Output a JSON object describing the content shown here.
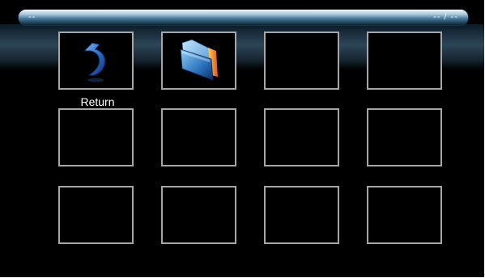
{
  "path_bar": {
    "path_text": "--",
    "page_counter": "-- / --"
  },
  "grid": {
    "items": [
      {
        "label": "Return",
        "icon": "return-arrow-icon",
        "selected": false
      },
      {
        "label": "",
        "icon": "folder-icon",
        "selected": false
      },
      {
        "label": "",
        "icon": "",
        "selected": false
      },
      {
        "label": "",
        "icon": "",
        "selected": false
      },
      {
        "label": "",
        "icon": "",
        "selected": false
      },
      {
        "label": "",
        "icon": "",
        "selected": false
      },
      {
        "label": "",
        "icon": "",
        "selected": false
      },
      {
        "label": "",
        "icon": "",
        "selected": false
      },
      {
        "label": "",
        "icon": "",
        "selected": false
      },
      {
        "label": "",
        "icon": "",
        "selected": false
      },
      {
        "label": "",
        "icon": "",
        "selected": false
      },
      {
        "label": "",
        "icon": "",
        "selected": false
      }
    ]
  },
  "colors": {
    "background": "#000000",
    "tile_border": "#a6a6a6",
    "bar_highlight": "#a9c9de",
    "bar_shadow": "#0f2433"
  }
}
